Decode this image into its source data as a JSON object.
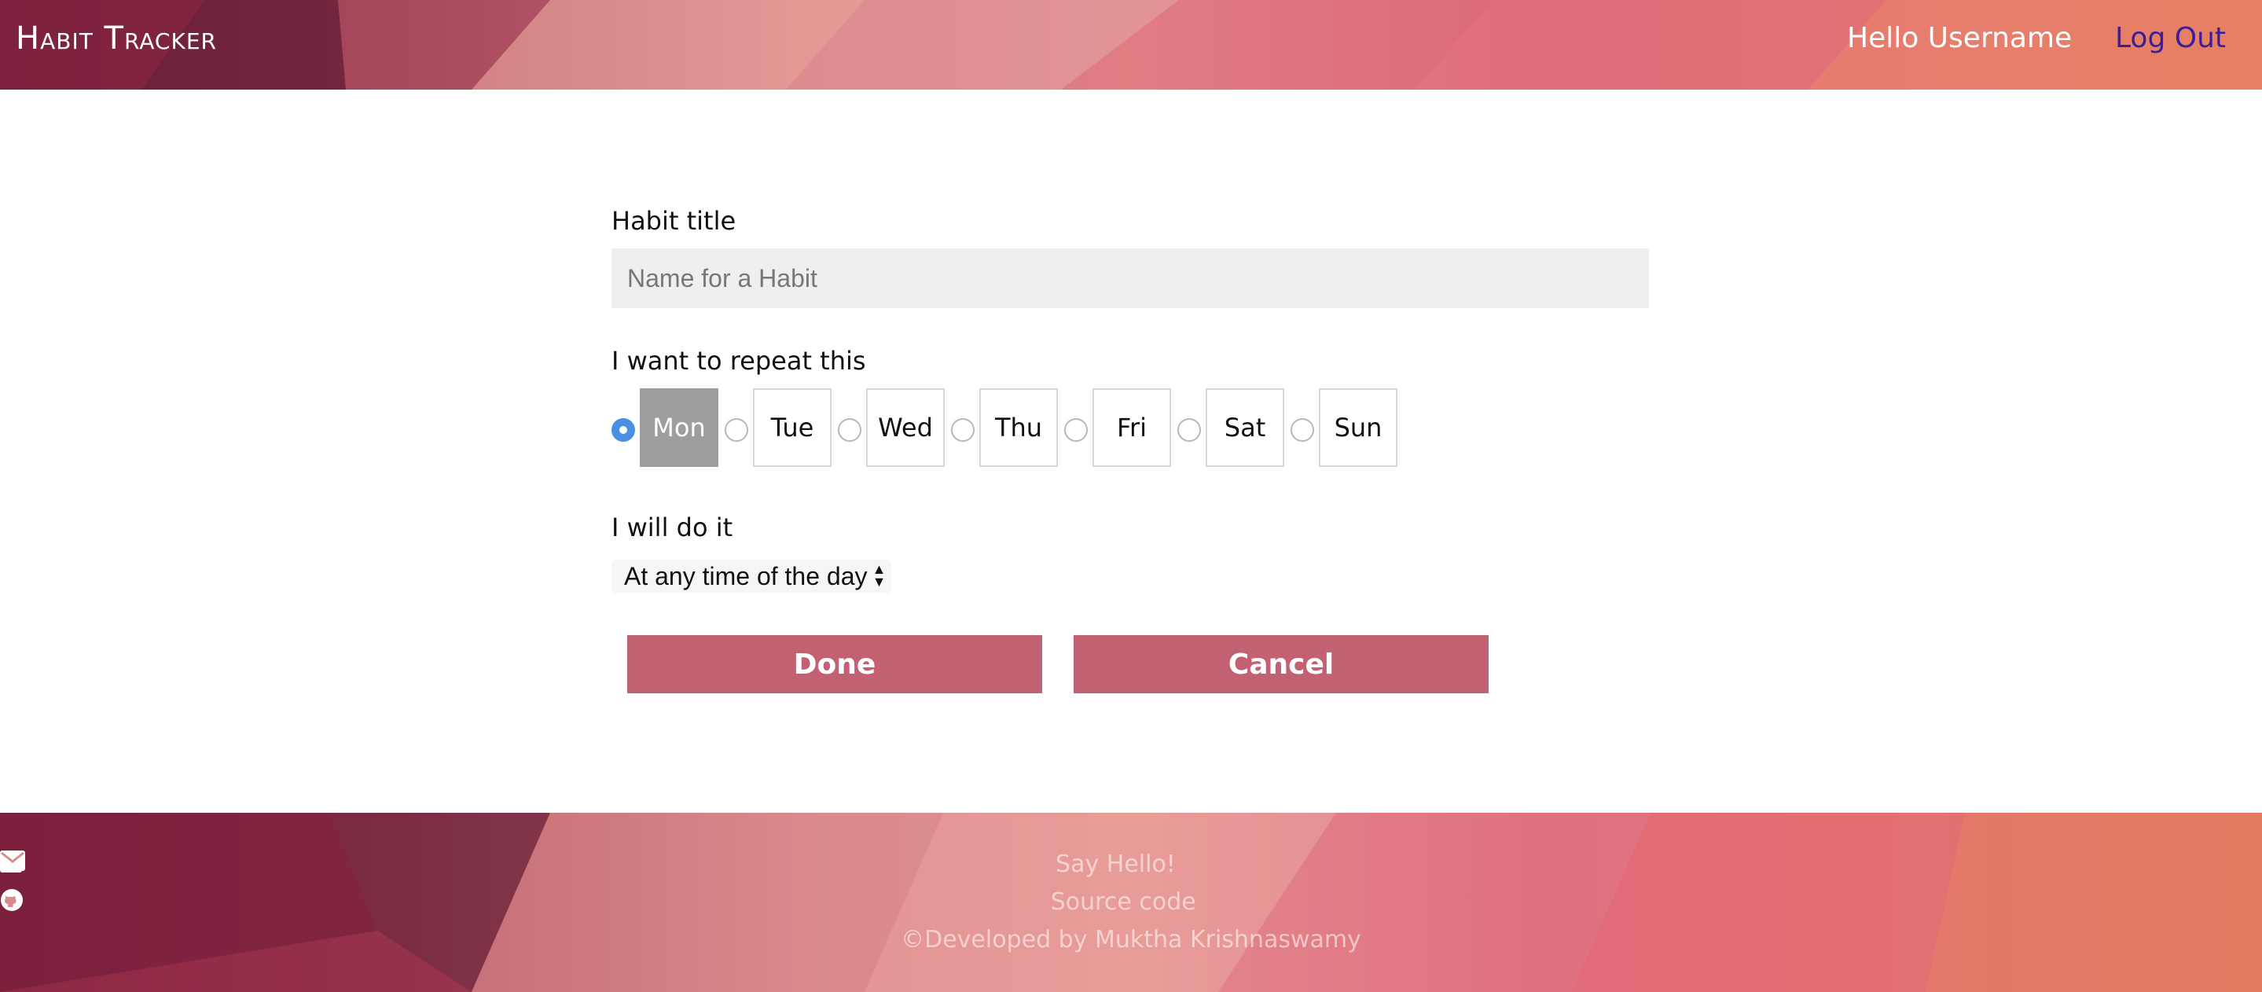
{
  "header": {
    "brand": "Habit Tracker",
    "greeting": "Hello Username",
    "logout_label": "Log Out"
  },
  "form": {
    "title_label": "Habit title",
    "title_placeholder": "Name for a Habit",
    "title_value": "",
    "repeat_label": "I want to repeat this",
    "days": [
      {
        "label": "Mon",
        "checked": true
      },
      {
        "label": "Tue",
        "checked": false
      },
      {
        "label": "Wed",
        "checked": false
      },
      {
        "label": "Thu",
        "checked": false
      },
      {
        "label": "Fri",
        "checked": false
      },
      {
        "label": "Sat",
        "checked": false
      },
      {
        "label": "Sun",
        "checked": false
      }
    ],
    "time_label": "I will do it",
    "time_selected": "At any time of the day",
    "done_label": "Done",
    "cancel_label": "Cancel"
  },
  "footer": {
    "say_hello": "Say Hello!",
    "source_code": "Source code",
    "credit": "©Developed by Muktha Krishnaswamy",
    "icons": [
      "linkedin-icon",
      "mail-icon",
      "github-icon"
    ]
  },
  "colors": {
    "button": "#c26172",
    "logout": "#3a1f9c",
    "selected_day": "#9e9e9e",
    "radio_checked": "#4a90e2"
  }
}
